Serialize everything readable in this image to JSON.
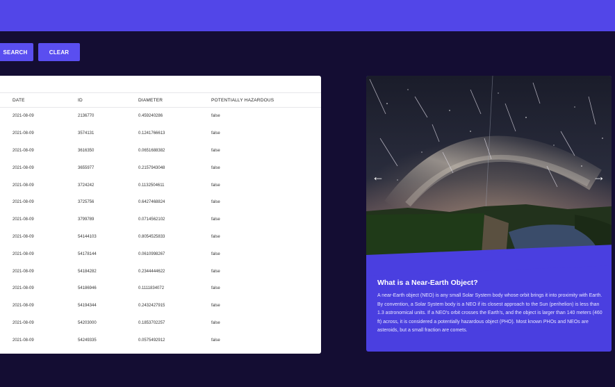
{
  "toolbar": {
    "search_label": "SEARCH",
    "clear_label": "CLEAR"
  },
  "table": {
    "columns": [
      "DATE",
      "ID",
      "DIAMETER",
      "POTENTIALLY HAZARDOUS"
    ],
    "rows": [
      [
        "2021-08-09",
        "2136770",
        "0.459240286",
        "false"
      ],
      [
        "2021-08-09",
        "3574131",
        "0.1241766613",
        "false"
      ],
      [
        "2021-08-09",
        "3616350",
        "0.0651688382",
        "false"
      ],
      [
        "2021-08-09",
        "3655977",
        "0.2157943048",
        "false"
      ],
      [
        "2021-08-09",
        "3724242",
        "0.1132504611",
        "false"
      ],
      [
        "2021-08-09",
        "3725756",
        "0.6427468824",
        "false"
      ],
      [
        "2021-08-09",
        "3799789",
        "0.0714562102",
        "false"
      ],
      [
        "2021-08-09",
        "54144103",
        "0.8054525833",
        "false"
      ],
      [
        "2021-08-09",
        "54178144",
        "0.0610998267",
        "false"
      ],
      [
        "2021-08-09",
        "54184282",
        "0.2344444622",
        "false"
      ],
      [
        "2021-08-09",
        "54186946",
        "0.1111834072",
        "false"
      ],
      [
        "2021-08-09",
        "54194344",
        "0.2432427915",
        "false"
      ],
      [
        "2021-08-09",
        "54203000",
        "0.1853702257",
        "false"
      ],
      [
        "2021-08-09",
        "54249335",
        "0.0575492912",
        "false"
      ]
    ]
  },
  "carousel": {
    "prev_icon": "arrow-left-icon",
    "next_icon": "arrow-right-icon",
    "prev_glyph": "←",
    "next_glyph": "→"
  },
  "info": {
    "title": "What is a Near-Earth Object?",
    "body": "A near-Earth object (NEO) is any small Solar System body whose orbit brings it into proximity with Earth. By convention, a Solar System body is a NEO if its closest approach to the Sun (perihelion) is less than 1.3 astronomical units. If a NEO's orbit crosses the Earth's, and the object is larger than 140 meters (460 ft) across, it is considered a potentially hazardous object (PHO). Most known PHOs and NEOs are asteroids, but a small fraction are comets."
  },
  "colors": {
    "background": "#140d33",
    "header": "#5246e8",
    "button": "#5a4ef0",
    "info_card": "#4a3fe0",
    "table_bg": "#ffffff"
  }
}
